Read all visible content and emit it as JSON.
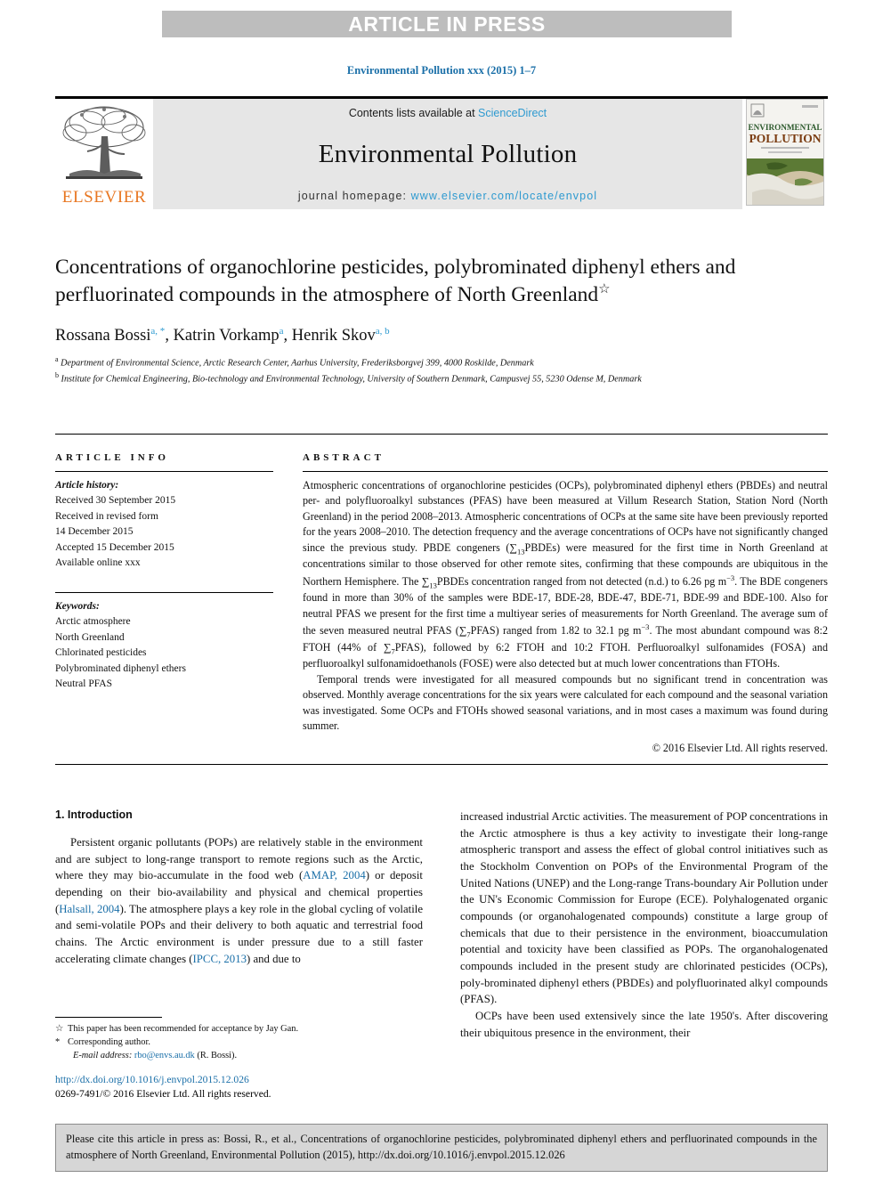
{
  "banner": {
    "label": "ARTICLE IN PRESS"
  },
  "running_head": "Environmental Pollution xxx (2015) 1–7",
  "masthead": {
    "contents_prefix": "Contents lists available at ",
    "sciencedirect": "ScienceDirect",
    "journal_name": "Environmental Pollution",
    "homepage_prefix": "journal homepage: ",
    "homepage_url": "www.elsevier.com/locate/envpol",
    "publisher": "ELSEVIER",
    "cover_title_line1": "ENVIRONMENTAL",
    "cover_title_line2": "POLLUTION"
  },
  "article": {
    "title": "Concentrations of organochlorine pesticides, polybrominated diphenyl ethers and perfluorinated compounds in the atmosphere of North Greenland",
    "title_marker": "☆",
    "authors": [
      {
        "name": "Rossana Bossi",
        "marks": "a, *"
      },
      {
        "name": "Katrin Vorkamp",
        "marks": "a"
      },
      {
        "name": "Henrik Skov",
        "marks": "a, b"
      }
    ],
    "affiliations": [
      {
        "mark": "a",
        "text": "Department of Environmental Science, Arctic Research Center, Aarhus University, Frederiksborgvej 399, 4000 Roskilde, Denmark"
      },
      {
        "mark": "b",
        "text": "Institute for Chemical Engineering, Bio-technology and Environmental Technology, University of Southern Denmark, Campusvej 55, 5230 Odense M, Denmark"
      }
    ]
  },
  "info": {
    "heading": "ARTICLE INFO",
    "history_title": "Article history:",
    "history": [
      "Received 30 September 2015",
      "Received in revised form",
      "14 December 2015",
      "Accepted 15 December 2015",
      "Available online xxx"
    ],
    "keywords_title": "Keywords:",
    "keywords": [
      "Arctic atmosphere",
      "North Greenland",
      "Chlorinated pesticides",
      "Polybrominated diphenyl ethers",
      "Neutral PFAS"
    ]
  },
  "abstract": {
    "heading": "ABSTRACT",
    "paragraph1_part1": "Atmospheric concentrations of organochlorine pesticides (OCPs), polybrominated diphenyl ethers (PBDEs) and neutral per- and polyfluoroalkyl substances (PFAS) have been measured at Villum Research Station, Station Nord (North Greenland) in the period 2008–2013. Atmospheric concentrations of OCPs at the same site have been previously reported for the years 2008–2010. The detection frequency and the average concentrations of OCPs have not significantly changed since the previous study. PBDE congeners (",
    "sum13_sym": "∑",
    "sum13_sub": "13",
    "paragraph1_part2": "PBDEs) were measured for the first time in North Greenland at concentrations similar to those observed for other remote sites, confirming that these compounds are ubiquitous in the Northern Hemisphere. The ",
    "paragraph1_part3": "PBDEs concentration ranged from not detected (n.d.) to 6.26 pg m",
    "sup_minus3": "−3",
    "paragraph1_part4": ". The BDE congeners found in more than 30% of the samples were BDE-17, BDE-28, BDE-47, BDE-71, BDE-99 and BDE-100. Also for neutral PFAS we present for the first time a multiyear series of measurements for North Greenland. The average sum of the seven measured neutral PFAS (",
    "sum7_sub": "7",
    "paragraph1_part5": "PFAS) ranged from 1.82 to 32.1 pg m",
    "paragraph1_part6": ". The most abundant compound was 8:2 FTOH (44% of ",
    "paragraph1_part7": "PFAS), followed by 6:2 FTOH and 10:2 FTOH. Perfluoroalkyl sulfonamides (FOSA) and perfluoroalkyl sulfonamidoethanols (FOSE) were also detected but at much lower concentrations than FTOHs.",
    "paragraph2": "Temporal trends were investigated for all measured compounds but no significant trend in concentration was observed. Monthly average concentrations for the six years were calculated for each compound and the seasonal variation was investigated. Some OCPs and FTOHs showed seasonal variations, and in most cases a maximum was found during summer.",
    "copyright": "© 2016 Elsevier Ltd. All rights reserved."
  },
  "introduction": {
    "heading": "1. Introduction",
    "left_part1": "Persistent organic pollutants (POPs) are relatively stable in the environment and are subject to long-range transport to remote regions such as the Arctic, where they may bio-accumulate in the food web (",
    "cite_amap": "AMAP, 2004",
    "left_part2": ") or deposit depending on their bio-availability and physical and chemical properties (",
    "cite_halsall": "Halsall, 2004",
    "left_part3": "). The atmosphere plays a key role in the global cycling of volatile and semi-volatile POPs and their delivery to both aquatic and terrestrial food chains. The Arctic environment is under pressure due to a still faster accelerating climate changes (",
    "cite_ipcc": "IPCC, 2013",
    "left_part4": ") and due to",
    "right_part1": "increased industrial Arctic activities. The measurement of POP concentrations in the Arctic atmosphere is thus a key activity to investigate their long-range atmospheric transport and assess the effect of global control initiatives such as the Stockholm Convention on POPs of the Environmental Program of the United Nations (UNEP) and the Long-range Trans-boundary Air Pollution under the UN's Economic Commission for Europe (ECE). Polyhalogenated organic compounds (or organohalogenated compounds) constitute a large group of chemicals that due to their persistence in the environment, bioaccumulation potential and toxicity have been classified as POPs. The organohalogenated compounds included in the present study are chlorinated pesticides (OCPs), poly-brominated diphenyl ethers (PBDEs) and polyfluorinated alkyl compounds (PFAS).",
    "right_part2": "OCPs have been used extensively since the late 1950's. After discovering their ubiquitous presence in the environment, their"
  },
  "footnotes": {
    "star_mark": "☆",
    "star_text": "This paper has been recommended for acceptance by Jay Gan.",
    "corr_mark": "*",
    "corr_text": "Corresponding author.",
    "email_label": "E-mail address:",
    "email": "rbo@envs.au.dk",
    "email_suffix": "(R. Bossi)."
  },
  "doi_block": {
    "doi_url": "http://dx.doi.org/10.1016/j.envpol.2015.12.026",
    "issn_line": "0269-7491/© 2016 Elsevier Ltd. All rights reserved."
  },
  "cite_box": {
    "text": "Please cite this article in press as: Bossi, R., et al., Concentrations of organochlorine pesticides, polybrominated diphenyl ethers and perfluorinated compounds in the atmosphere of North Greenland, Environmental Pollution (2015), http://dx.doi.org/10.1016/j.envpol.2015.12.026"
  },
  "colors": {
    "banner_bg": "#bdbdbd",
    "link": "#1a6fa8",
    "sciencedirect": "#2e9ad0",
    "elsevier_orange": "#e87722",
    "masthead_bg": "#e6e6e6",
    "citebox_bg": "#d6d6d6"
  }
}
